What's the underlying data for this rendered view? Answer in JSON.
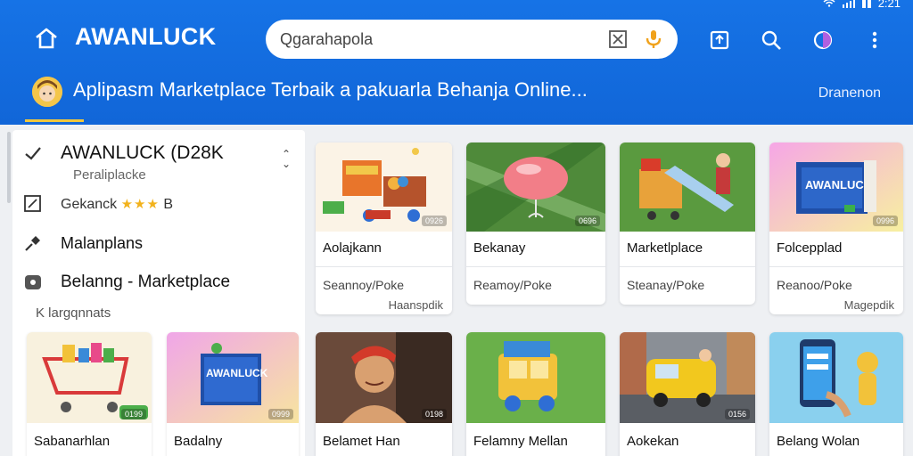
{
  "header": {
    "status_time": "2:21",
    "brand": "AWANLUCK",
    "search_value": "Qgarahapola",
    "banner_title": "Aplipasm Marketplace Terbaik a pakuarla Behanja Online...",
    "banner_link": "Dranenon"
  },
  "sidebar": {
    "store_name": "AWANLUCK (D28K",
    "store_sub": "Peraliplacke",
    "rating_label": "Gekanck",
    "rating_stars": "★★★",
    "rating_suffix": "B",
    "item3": "Malanplans",
    "item4": "Belanng - Marketplace",
    "category_label": "K largqnnats"
  },
  "products_top": [
    {
      "title": "Aolajkann",
      "sub": "Seannoy/Poke",
      "sub2": "Haanspdik",
      "tag": "0926"
    },
    {
      "title": "Bekanay",
      "sub": "Reamoy/Poke",
      "sub2": "",
      "tag": "0696"
    },
    {
      "title": "Marketlplace",
      "sub": "Steanay/Poke",
      "sub2": "",
      "tag": ""
    },
    {
      "title": "Folcepplad",
      "sub": "Reanoo/Poke",
      "sub2": "Magepdik",
      "tag": "0996"
    }
  ],
  "products_bottom": [
    {
      "title": "Sabanarhlan",
      "tag": "0199"
    },
    {
      "title": "Badalny",
      "tag": "0999"
    },
    {
      "title": "Belamet Han",
      "tag": "0198"
    },
    {
      "title": "Felamny Mellan",
      "tag": ""
    },
    {
      "title": "Aokekan",
      "tag": "0156"
    },
    {
      "title": "Belang Wolan",
      "tag": ""
    }
  ],
  "colors": {
    "brand_blue": "#1673e6",
    "accent_yellow": "#f0c63c",
    "mic_orange": "#f0a21c"
  },
  "icons": [
    "home-icon",
    "close-box-icon",
    "mic-icon",
    "share-icon",
    "search-icon",
    "theme-icon",
    "more-vert-icon",
    "check-icon",
    "edit-icon",
    "pin-icon",
    "bag-icon"
  ]
}
